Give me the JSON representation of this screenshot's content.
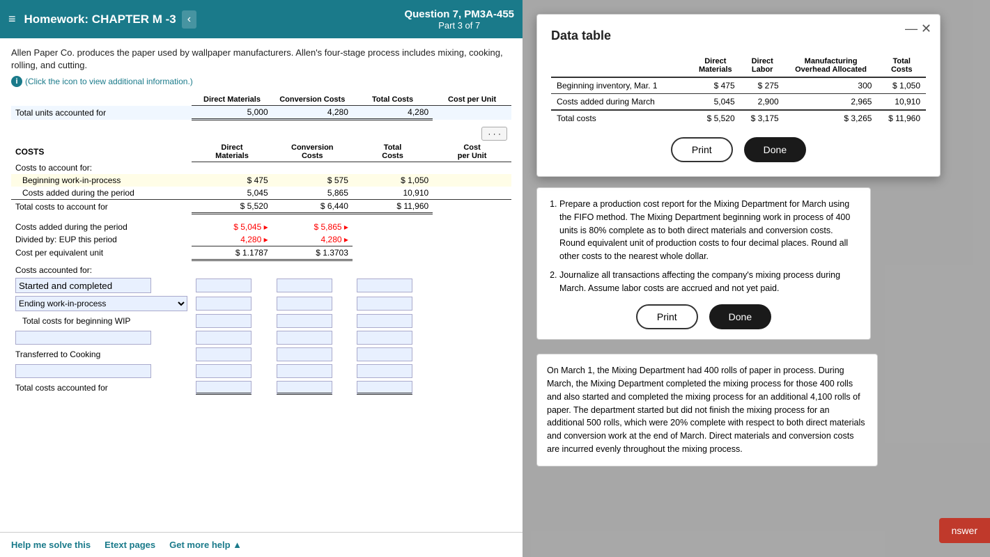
{
  "header": {
    "menu_icon": "≡",
    "title": "Homework:  CHAPTER M -3",
    "nav_arrow": "‹",
    "question_title": "Question 7, PM3A-455",
    "part_info": "Part 3 of 7"
  },
  "problem": {
    "description": "Allen Paper Co. produces the paper used by wallpaper manufacturers. Allen's four-stage process includes mixing, cooking, rolling, and cutting.",
    "info_link": "(Click the icon to view additional information.)"
  },
  "table": {
    "units_label": "Total units accounted for",
    "units_values": [
      "5,000",
      "4,280",
      "4,280"
    ],
    "costs_section": "COSTS",
    "col_headers": [
      "Direct Materials",
      "Conversion Costs",
      "Total Costs",
      "Cost per Unit"
    ],
    "costs_to_account_for": "Costs to account for:",
    "beginning_wip": "Beginning work-in-process",
    "beginning_values": [
      "$ 475",
      "$ 575",
      "$ 1,050"
    ],
    "costs_added": "Costs added during the period",
    "costs_added_values": [
      "5,045",
      "5,865",
      "10,910"
    ],
    "total_costs": "Total costs to account for",
    "total_costs_values": [
      "$ 5,520",
      "$ 6,440",
      "$ 11,960"
    ],
    "costs_added_period": "Costs added during the period",
    "costs_added_period_values": [
      "$ 5,045",
      "$ 5,865"
    ],
    "divided_by": "Divided by: EUP this period",
    "divided_by_values": [
      "4,280",
      "4,280"
    ],
    "cost_per_eu": "Cost per equivalent unit",
    "cost_per_eu_values": [
      "$ 1.1787",
      "$ 1.3703"
    ],
    "costs_accounted_for": "Costs accounted for:",
    "started_completed": "Started and completed",
    "ending_wip": "Ending work-in-process",
    "total_costs_beginning_wip": "Total costs for beginning WIP",
    "transferred_to_cooking": "Transferred to Cooking",
    "total_costs_accounted_for": "Total costs accounted for"
  },
  "data_table_modal": {
    "title": "Data table",
    "close_icon": "✕",
    "minimize_icon": "—",
    "col_headers": [
      "",
      "Direct Materials",
      "Direct Labor",
      "Manufacturing Overhead Allocated",
      "Total Costs"
    ],
    "rows": [
      {
        "label": "Beginning inventory, Mar. 1",
        "dm": "$ 475",
        "dl": "$ 275",
        "moh": "300",
        "total": "$ 1,050"
      },
      {
        "label": "Costs added during March",
        "dm": "5,045",
        "dl": "2,900",
        "moh": "2,965",
        "total": "10,910"
      },
      {
        "label": "Total costs",
        "dm": "$ 5,520",
        "dl": "$ 3,175",
        "moh": "$ 3,265",
        "total": "$ 11,960"
      }
    ],
    "print_label": "Print",
    "done_label": "Done"
  },
  "instruction_box": {
    "items": [
      "Prepare a production cost report for the Mixing Department for March using the FIFO method. The Mixing Department beginning work in process of 400 units is 80% complete as to both direct materials and conversion costs. Round equivalent unit of production costs to four decimal places. Round all other costs to the nearest whole dollar.",
      "Journalize all transactions affecting the company's mixing process during March. Assume labor costs are accrued and not yet paid."
    ],
    "print_label": "Print",
    "done_label": "Done"
  },
  "info_text": "On March 1, the Mixing Department had 400 rolls of paper in process. During March, the Mixing Department completed the mixing process for those 400 rolls and also started and completed the mixing process for an additional 4,100 rolls of paper. The department started but did not finish the mixing process for an additional 500 rolls, which were 20% complete with respect to both direct materials and conversion work at the end of March. Direct materials and conversion costs are incurred evenly throughout the mixing process.",
  "bottom_bar": {
    "help_label": "Help me solve this",
    "etext_label": "Etext pages",
    "more_help_label": "Get more help ▲"
  },
  "answer_button": "nswer"
}
